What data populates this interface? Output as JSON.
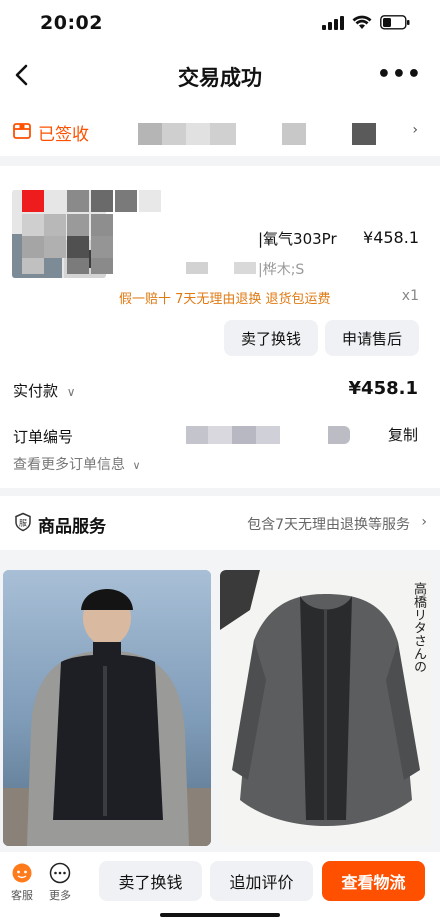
{
  "status": {
    "time": "20:02"
  },
  "nav": {
    "title": "交易成功"
  },
  "sign": {
    "label": "已签收"
  },
  "product": {
    "title_fragment": "|氧气303Pr",
    "price": "¥458.1",
    "sku_fragment": "|桦木;S",
    "guarantees": "假一赔十  7天无理由退换  退货包运费",
    "qty": "x1"
  },
  "actions": {
    "sell_label": "卖了换钱",
    "aftersale_label": "申请售后"
  },
  "payment": {
    "label": "实付款",
    "value": "¥458.1"
  },
  "order": {
    "label": "订单编号",
    "copy_label": "复制",
    "more_info": "查看更多订单信息"
  },
  "service": {
    "title": "商品服务",
    "desc": "包含7天无理由退换等服务"
  },
  "recommend": {
    "img2_text": "高橋リタさんの"
  },
  "bottom": {
    "service_label": "客服",
    "more_label": "更多",
    "sell_label": "卖了换钱",
    "review_label": "追加评价",
    "logistics_label": "查看物流"
  },
  "colors": {
    "accent": "#ff5000",
    "guarantee": "#e07a14"
  }
}
